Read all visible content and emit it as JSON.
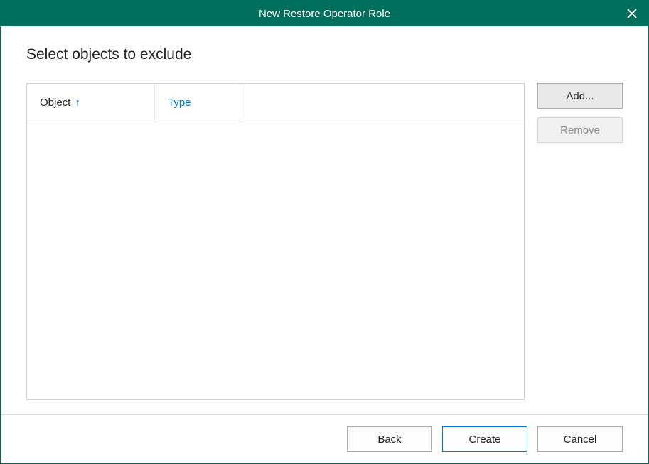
{
  "titlebar": {
    "title": "New Restore Operator Role"
  },
  "heading": "Select objects to exclude",
  "table": {
    "columns": {
      "object": "Object",
      "type": "Type"
    },
    "sort_indicator": "↑",
    "rows": []
  },
  "side": {
    "add": "Add...",
    "remove": "Remove"
  },
  "footer": {
    "back": "Back",
    "create": "Create",
    "cancel": "Cancel"
  }
}
